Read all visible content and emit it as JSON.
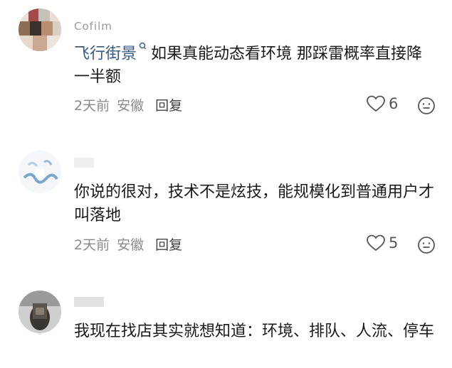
{
  "comments": [
    {
      "username": "Cofilm",
      "mention": "飞行街景",
      "text": "如果真能动态看环境 那踩雷概率直接降一半额",
      "time": "2天前",
      "location": "安徽",
      "reply_label": "回复",
      "likes": "6"
    },
    {
      "username": "",
      "text": "你说的很对，技术不是炫技，能规模化到普通用户才叫落地",
      "time": "2天前",
      "location": "安徽",
      "reply_label": "回复",
      "likes": "5"
    },
    {
      "username": "",
      "text": "我现在找店其实就想知道：环境、排队、人流、停车"
    }
  ],
  "icons": {
    "like": "heart-outline-icon",
    "react": "smiley-face-icon",
    "mention_marker": "search-person-icon"
  },
  "colors": {
    "mention": "#3a5a86",
    "meta": "#8a8a8a",
    "text": "#1a1a1a"
  }
}
